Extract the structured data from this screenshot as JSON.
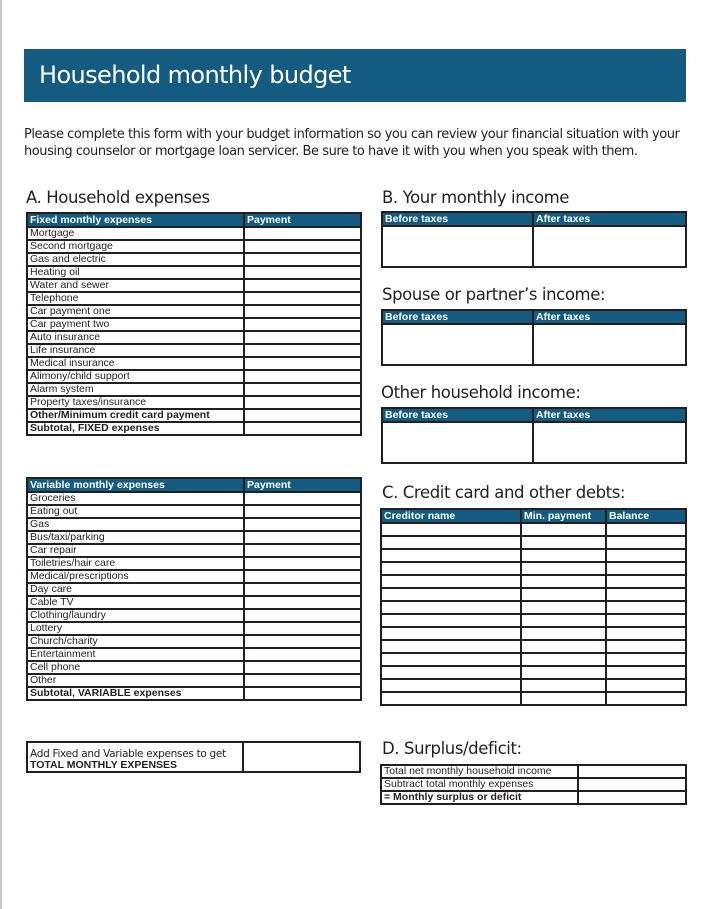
{
  "title": "Household monthly budget",
  "intro": "Please complete this form with your budget information so you can review your financial situation with your housing counselor or mortgage loan servicer. Be sure to have it with you when you speak with them.",
  "colors": {
    "header_bg": "#135b80",
    "border": "#231f20"
  },
  "section_a": {
    "title": "A. Household expenses",
    "fixed": {
      "header": [
        "Fixed monthly expenses",
        "Payment"
      ],
      "rows": [
        "Mortgage",
        "Second mortgage",
        "Gas and electric",
        "Heating oil",
        "Water and sewer",
        "Telephone",
        "Car payment one",
        "Car payment two",
        "Auto insurance",
        "Life insurance",
        "Medical insurance",
        "Alimony/child support",
        "Alarm system",
        "Property taxes/insurance"
      ],
      "bold_rows": [
        "Other/Minimum credit card payment",
        "Subtotal, FIXED expenses"
      ]
    },
    "variable": {
      "header": [
        "Variable monthly expenses",
        "Payment"
      ],
      "rows": [
        "Groceries",
        "Eating out",
        "Gas",
        "Bus/taxi/parking",
        "Car repair",
        "Toiletries/hair care",
        "Medical/prescriptions",
        "Day care",
        "Cable TV",
        "Clothing/laundry",
        "Lottery",
        "Church/charity",
        "Entertainment",
        "Cell phone",
        "Other"
      ],
      "bold_rows": [
        "Subtotal, VARIABLE expenses"
      ]
    },
    "total": {
      "line1": "Add Fixed and Variable expenses to get",
      "line2": "TOTAL MONTHLY EXPENSES"
    }
  },
  "section_b": {
    "title": "B. Your monthly income",
    "columns": [
      "Before taxes",
      "After taxes"
    ],
    "spouse_title": "Spouse or partner’s income:",
    "other_title": "Other household income:"
  },
  "section_c": {
    "title": "C. Credit card and other debts:",
    "columns": [
      "Creditor name",
      "Min. payment",
      "Balance"
    ],
    "blank_rows": 14
  },
  "section_d": {
    "title": "D. Surplus/deficit:",
    "rows": [
      "Total net monthly household income",
      "Subtract total monthly expenses"
    ],
    "bold_row": "= Monthly surplus or deficit"
  }
}
